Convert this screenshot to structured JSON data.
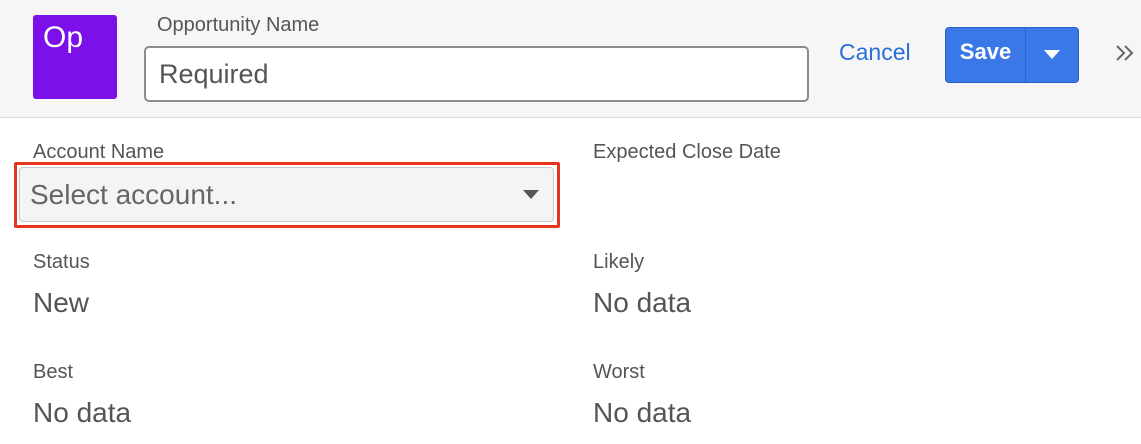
{
  "header": {
    "module_badge": "Op",
    "name_label": "Opportunity Name",
    "name_placeholder": "Required",
    "cancel_label": "Cancel",
    "save_label": "Save"
  },
  "form": {
    "account": {
      "label": "Account Name",
      "placeholder": "Select account..."
    },
    "close_date": {
      "label": "Expected Close Date"
    },
    "status": {
      "label": "Status",
      "value": "New"
    },
    "likely": {
      "label": "Likely",
      "value": "No data"
    },
    "best": {
      "label": "Best",
      "value": "No data"
    },
    "worst": {
      "label": "Worst",
      "value": "No data"
    }
  },
  "colors": {
    "module_badge": "#7b10e8",
    "primary_button": "#3b78e7",
    "link": "#2b6fd6",
    "highlight_border": "#e8341c"
  },
  "icons": {
    "save_menu": "caret-down-icon",
    "account_dropdown": "caret-down-icon",
    "collapse_panel": "double-chevron-right-icon"
  }
}
